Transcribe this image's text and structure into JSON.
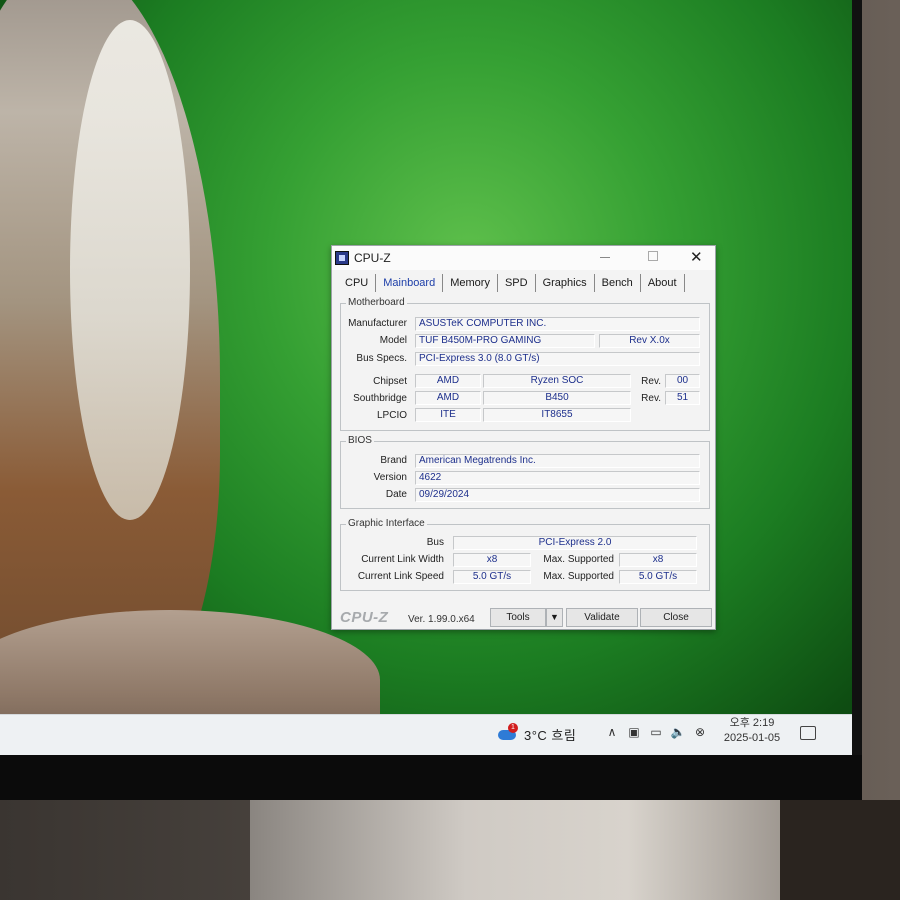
{
  "window": {
    "title": "CPU-Z",
    "tabs": [
      "CPU",
      "Mainboard",
      "Memory",
      "SPD",
      "Graphics",
      "Bench",
      "About"
    ],
    "active_tab": "Mainboard"
  },
  "motherboard": {
    "group_label": "Motherboard",
    "manufacturer_label": "Manufacturer",
    "manufacturer": "ASUSTeK COMPUTER INC.",
    "model_label": "Model",
    "model": "TUF B450M-PRO GAMING",
    "model_rev": "Rev X.0x",
    "bus_label": "Bus Specs.",
    "bus": "PCI-Express 3.0 (8.0 GT/s)",
    "chipset_label": "Chipset",
    "chipset_vendor": "AMD",
    "chipset_name": "Ryzen SOC",
    "chipset_rev_label": "Rev.",
    "chipset_rev": "00",
    "southbridge_label": "Southbridge",
    "southbridge_vendor": "AMD",
    "southbridge_name": "B450",
    "southbridge_rev_label": "Rev.",
    "southbridge_rev": "51",
    "lpcio_label": "LPCIO",
    "lpcio_vendor": "ITE",
    "lpcio_name": "IT8655"
  },
  "bios": {
    "group_label": "BIOS",
    "brand_label": "Brand",
    "brand": "American Megatrends Inc.",
    "version_label": "Version",
    "version": "4622",
    "date_label": "Date",
    "date": "09/29/2024"
  },
  "graphic_interface": {
    "group_label": "Graphic Interface",
    "bus_label": "Bus",
    "bus": "PCI-Express 2.0",
    "link_width_label": "Current Link Width",
    "link_width": "x8",
    "max_width_label": "Max. Supported",
    "max_width": "x8",
    "link_speed_label": "Current Link Speed",
    "link_speed": "5.0 GT/s",
    "max_speed_label": "Max. Supported",
    "max_speed": "5.0 GT/s"
  },
  "footer": {
    "logo": "CPU-Z",
    "version": "Ver. 1.99.0.x64",
    "tools_label": "Tools",
    "validate_label": "Validate",
    "close_label": "Close"
  },
  "taskbar": {
    "weather_badge": "1",
    "weather_text": "3°C 흐림",
    "time": "오후 2:19",
    "date": "2025-01-05"
  }
}
